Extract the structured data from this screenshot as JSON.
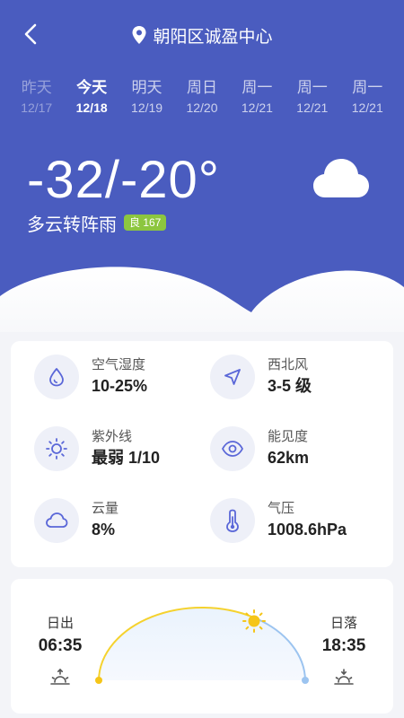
{
  "header": {
    "location": "朝阳区诚盈中心"
  },
  "days": [
    {
      "name": "昨天",
      "date": "12/17"
    },
    {
      "name": "今天",
      "date": "12/18"
    },
    {
      "name": "明天",
      "date": "12/19"
    },
    {
      "name": "周日",
      "date": "12/20"
    },
    {
      "name": "周一",
      "date": "12/21"
    },
    {
      "name": "周一",
      "date": "12/21"
    },
    {
      "name": "周一",
      "date": "12/21"
    }
  ],
  "current": {
    "temperature": "-32/-20°",
    "condition": "多云转阵雨",
    "aqi": "良 167",
    "weather_icon": "cloud-icon"
  },
  "details": [
    {
      "label": "空气湿度",
      "value": "10-25%",
      "icon": "humidity-icon"
    },
    {
      "label": "西北风",
      "value": "3-5 级",
      "icon": "wind-direction-icon"
    },
    {
      "label": "紫外线",
      "value": "最弱 1/10",
      "icon": "sun-uv-icon"
    },
    {
      "label": "能见度",
      "value": "62km",
      "icon": "eye-icon"
    },
    {
      "label": "云量",
      "value": "8%",
      "icon": "cloud-icon"
    },
    {
      "label": "气压",
      "value": "1008.6hPa",
      "icon": "thermometer-icon"
    }
  ],
  "sun": {
    "sunrise_label": "日出",
    "sunrise_time": "06:35",
    "sunset_label": "日落",
    "sunset_time": "18:35"
  },
  "colors": {
    "primary": "#4a5cbf",
    "icon": "#5a67d8",
    "aqi_badge": "#8cc63f",
    "sun_arc": "#f5d22e",
    "sun_arc_night": "#9cc4f0"
  }
}
